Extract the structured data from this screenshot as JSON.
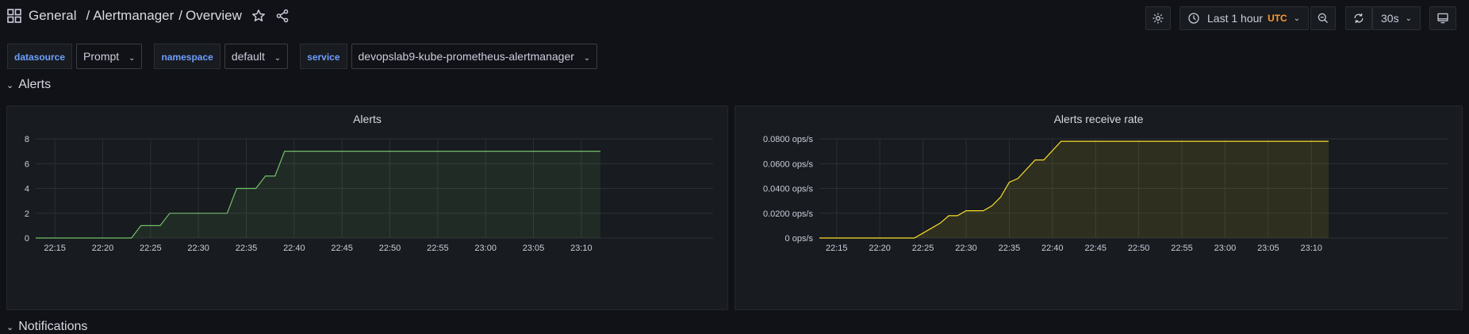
{
  "breadcrumb": {
    "root": "General",
    "separator": "/",
    "folder": "Alertmanager",
    "page": "Overview"
  },
  "toolbar": {
    "time_range": "Last 1 hour",
    "timezone": "UTC",
    "refresh_interval": "30s",
    "icons": [
      "dashboard-settings-icon",
      "clock-icon",
      "zoom-out-icon",
      "refresh-icon",
      "tv-mode-icon"
    ]
  },
  "variables": [
    {
      "label": "datasource",
      "value": "Prompt"
    },
    {
      "label": "namespace",
      "value": "default"
    },
    {
      "label": "service",
      "value": "devopslab9-kube-prometheus-alertmanager"
    }
  ],
  "rows": {
    "alerts": "Alerts",
    "notifications": "Notifications"
  },
  "colors": {
    "series_green": "#73bf69",
    "series_yellow": "#fade2a",
    "label_blue": "#6e9fff",
    "utc": "#ff9830"
  },
  "chart_data": [
    {
      "type": "area",
      "title": "Alerts",
      "x": [
        "22:15",
        "22:20",
        "22:25",
        "22:30",
        "22:35",
        "22:40",
        "22:45",
        "22:50",
        "22:55",
        "23:00",
        "23:05",
        "23:10"
      ],
      "ylim": [
        0,
        8
      ],
      "yticks": [
        "0",
        "2",
        "4",
        "6",
        "8"
      ],
      "series": [
        {
          "points": [
            [
              "22:13",
              0
            ],
            [
              "22:23",
              0
            ],
            [
              "22:24",
              1
            ],
            [
              "22:26",
              1
            ],
            [
              "22:27",
              2
            ],
            [
              "22:33",
              2
            ],
            [
              "22:34",
              4
            ],
            [
              "22:36",
              4
            ],
            [
              "22:37",
              5
            ],
            [
              "22:38",
              5
            ],
            [
              "22:39",
              7
            ],
            [
              "23:12",
              7
            ]
          ]
        }
      ],
      "grid": true
    },
    {
      "type": "area",
      "title": "Alerts receive rate",
      "x": [
        "22:15",
        "22:20",
        "22:25",
        "22:30",
        "22:35",
        "22:40",
        "22:45",
        "22:50",
        "22:55",
        "23:00",
        "23:05",
        "23:10"
      ],
      "ylim": [
        0,
        0.08
      ],
      "yticks": [
        "0 ops/s",
        "0.0200 ops/s",
        "0.0400 ops/s",
        "0.0600 ops/s",
        "0.0800 ops/s"
      ],
      "series": [
        {
          "points": [
            [
              "22:13",
              0
            ],
            [
              "22:24",
              0
            ],
            [
              "22:25",
              0.004
            ],
            [
              "22:27",
              0.012
            ],
            [
              "22:28",
              0.018
            ],
            [
              "22:29",
              0.018
            ],
            [
              "22:30",
              0.022
            ],
            [
              "22:32",
              0.022
            ],
            [
              "22:33",
              0.026
            ],
            [
              "22:34",
              0.033
            ],
            [
              "22:35",
              0.045
            ],
            [
              "22:36",
              0.048
            ],
            [
              "22:38",
              0.063
            ],
            [
              "22:39",
              0.063
            ],
            [
              "22:41",
              0.078
            ],
            [
              "23:12",
              0.078
            ]
          ]
        }
      ],
      "grid": true
    }
  ]
}
